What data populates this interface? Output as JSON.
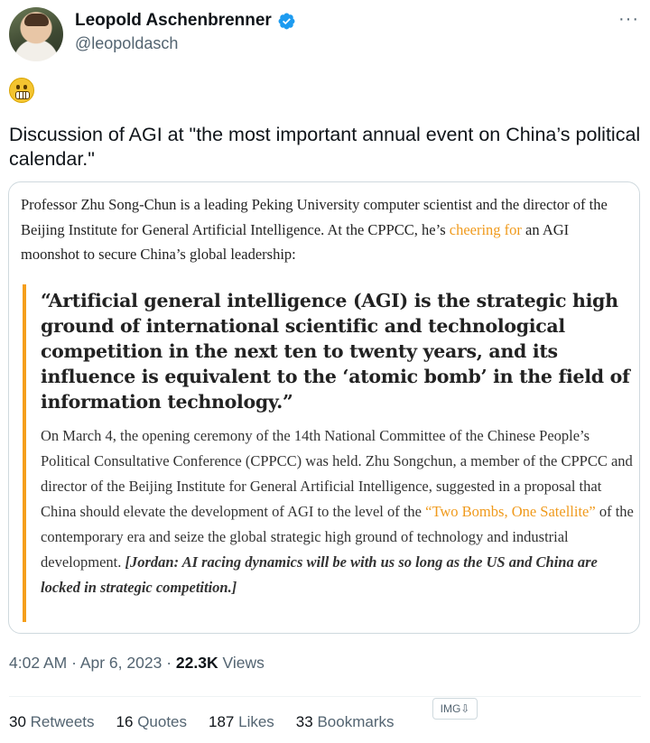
{
  "author": {
    "display_name": "Leopold Aschenbrenner",
    "handle": "@leopoldasch"
  },
  "menu_glyph": "···",
  "tweet": {
    "text": "Discussion of AGI at \"the most important annual event on China’s political calendar.\""
  },
  "quote_card": {
    "intro_before_link": "Professor Zhu Song-Chun is a leading Peking University computer scientist and the director of the Beijing Institute for General Artificial Intelligence. At the CPPCC, he’s ",
    "intro_link": "cheering for",
    "intro_after_link": " an AGI moonshot to secure China’s global leadership:",
    "pull_quote": "“Artificial general intelligence (AGI) is the strategic high ground of international scientific and technological competition in the next ten to twenty years, and its influence is equivalent to the ‘atomic bomb’ in the field of information technology.”",
    "body_before_link": "On March 4, the opening ceremony of the 14th National Committee of the Chinese People’s Political Consultative Conference (CPPCC) was held. Zhu Songchun, a member of the CPPCC and director of the Beijing Institute for General Artificial Intelligence, suggested in a proposal that China should elevate the development of AGI to the level of the ",
    "body_link": "“Two Bombs, One Satellite”",
    "body_after_link": " of the contemporary era and seize the global strategic high ground of technology and industrial development.",
    "editor_note": "[Jordan: AI racing dynamics will be with us so long as the US and China are locked in strategic competition.]"
  },
  "meta": {
    "time": "4:02 AM",
    "separator": "·",
    "date": "Apr 6, 2023",
    "views_count": "22.3K",
    "views_label": "Views"
  },
  "stats": {
    "retweets_count": "30",
    "retweets_label": "Retweets",
    "quotes_count": "16",
    "quotes_label": "Quotes",
    "likes_count": "187",
    "likes_label": "Likes",
    "bookmarks_count": "33",
    "bookmarks_label": "Bookmarks"
  },
  "img_badge": "IMG⇩",
  "colors": {
    "verified": "#1d9bf0",
    "link_orange": "#f09a1c",
    "quote_bar": "#f59e1b",
    "muted_text": "#536471"
  },
  "icons": {
    "verified": "verified-badge-icon",
    "emoji": "grimacing-face-icon",
    "menu": "more-options-icon"
  }
}
